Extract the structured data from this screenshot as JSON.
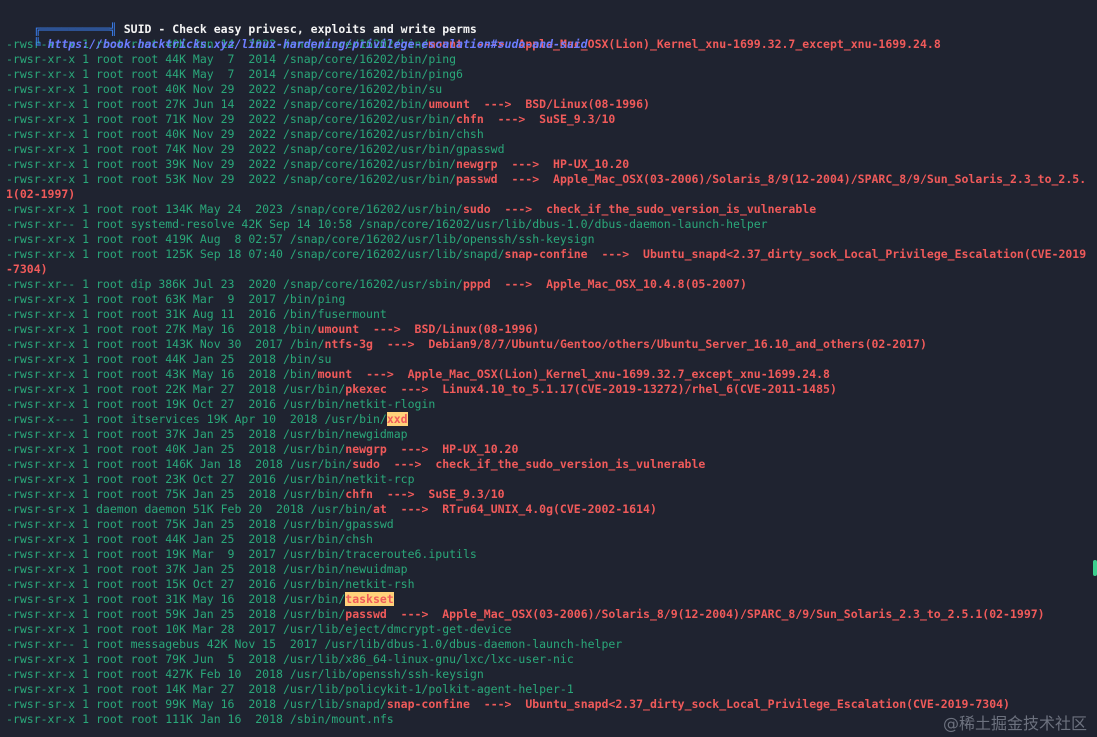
{
  "header": {
    "bracket_top": "╔══════════╣",
    "title": "SUID - Check easy privesc, exploits and write perms",
    "bracket_bottom": "╚ ",
    "url": "https://book.hacktricks.xyz/linux-hardening/privilege-escalation#sudo-and-suid"
  },
  "arrow": "--->",
  "rows": [
    {
      "meta": "-rwsr-xr-x 1 root root 40K Jun 14  2022 ",
      "dir": "/snap/core/16202/bin/",
      "bin": "mount",
      "style": "red",
      "exploit": "Apple_Mac_OSX(Lion)_Kernel_xnu-1699.32.7_except_xnu-1699.24.8"
    },
    {
      "meta": "-rwsr-xr-x 1 root root 44K May  7  2014 ",
      "dir": "/snap/core/16202/bin/",
      "bin": "ping",
      "style": "plain",
      "exploit": ""
    },
    {
      "meta": "-rwsr-xr-x 1 root root 44K May  7  2014 ",
      "dir": "/snap/core/16202/bin/",
      "bin": "ping6",
      "style": "plain",
      "exploit": ""
    },
    {
      "meta": "-rwsr-xr-x 1 root root 40K Nov 29  2022 ",
      "dir": "/snap/core/16202/bin/",
      "bin": "su",
      "style": "plain",
      "exploit": ""
    },
    {
      "meta": "-rwsr-xr-x 1 root root 27K Jun 14  2022 ",
      "dir": "/snap/core/16202/bin/",
      "bin": "umount",
      "style": "red",
      "exploit": "BSD/Linux(08-1996)"
    },
    {
      "meta": "-rwsr-xr-x 1 root root 71K Nov 29  2022 ",
      "dir": "/snap/core/16202/usr/bin/",
      "bin": "chfn",
      "style": "red",
      "exploit": "SuSE_9.3/10"
    },
    {
      "meta": "-rwsr-xr-x 1 root root 40K Nov 29  2022 ",
      "dir": "/snap/core/16202/usr/bin/",
      "bin": "chsh",
      "style": "plain",
      "exploit": ""
    },
    {
      "meta": "-rwsr-xr-x 1 root root 74K Nov 29  2022 ",
      "dir": "/snap/core/16202/usr/bin/",
      "bin": "gpasswd",
      "style": "plain",
      "exploit": ""
    },
    {
      "meta": "-rwsr-xr-x 1 root root 39K Nov 29  2022 ",
      "dir": "/snap/core/16202/usr/bin/",
      "bin": "newgrp",
      "style": "red",
      "exploit": "HP-UX_10.20"
    },
    {
      "meta": "-rwsr-xr-x 1 root root 53K Nov 29  2022 ",
      "dir": "/snap/core/16202/usr/bin/",
      "bin": "passwd",
      "style": "red",
      "exploit": "Apple_Mac_OSX(03-2006)/Solaris_8/9(12-2004)/SPARC_8/9/Sun_Solaris_2.3_to_2.5.1(02-1997)",
      "wrap": true
    },
    {
      "meta": "-rwsr-xr-x 1 root root 134K May 24  2023 ",
      "dir": "/snap/core/16202/usr/bin/",
      "bin": "sudo",
      "style": "red",
      "exploit": "check_if_the_sudo_version_is_vulnerable"
    },
    {
      "meta": "-rwsr-xr-- 1 root systemd-resolve 42K Sep 14 10:58 ",
      "dir": "/snap/core/16202/usr/lib/dbus-1.0/",
      "bin": "dbus-daemon-launch-helper",
      "style": "plain",
      "exploit": ""
    },
    {
      "meta": "-rwsr-xr-x 1 root root 419K Aug  8 02:57 ",
      "dir": "/snap/core/16202/usr/lib/openssh/",
      "bin": "ssh-keysign",
      "style": "plain",
      "exploit": ""
    },
    {
      "meta": "-rwsr-xr-x 1 root root 125K Sep 18 07:40 ",
      "dir": "/snap/core/16202/usr/lib/snapd/",
      "bin": "snap-confine",
      "style": "red",
      "exploit": "Ubuntu_snapd<2.37_dirty_sock_Local_Privilege_Escalation(CVE-2019-7304)",
      "wrap": true
    },
    {
      "meta": "-rwsr-xr-- 1 root dip 386K Jul 23  2020 ",
      "dir": "/snap/core/16202/usr/sbin/",
      "bin": "pppd",
      "style": "red",
      "exploit": "Apple_Mac_OSX_10.4.8(05-2007)"
    },
    {
      "meta": "-rwsr-xr-x 1 root root 63K Mar  9  2017 ",
      "dir": "/bin/",
      "bin": "ping",
      "style": "plain",
      "exploit": ""
    },
    {
      "meta": "-rwsr-xr-x 1 root root 31K Aug 11  2016 ",
      "dir": "/bin/",
      "bin": "fusermount",
      "style": "plain",
      "exploit": ""
    },
    {
      "meta": "-rwsr-xr-x 1 root root 27K May 16  2018 ",
      "dir": "/bin/",
      "bin": "umount",
      "style": "red",
      "exploit": "BSD/Linux(08-1996)"
    },
    {
      "meta": "-rwsr-xr-x 1 root root 143K Nov 30  2017 ",
      "dir": "/bin/",
      "bin": "ntfs-3g",
      "style": "red",
      "exploit": "Debian9/8/7/Ubuntu/Gentoo/others/Ubuntu_Server_16.10_and_others(02-2017)"
    },
    {
      "meta": "-rwsr-xr-x 1 root root 44K Jan 25  2018 ",
      "dir": "/bin/",
      "bin": "su",
      "style": "plain",
      "exploit": ""
    },
    {
      "meta": "-rwsr-xr-x 1 root root 43K May 16  2018 ",
      "dir": "/bin/",
      "bin": "mount",
      "style": "red",
      "exploit": "Apple_Mac_OSX(Lion)_Kernel_xnu-1699.32.7_except_xnu-1699.24.8"
    },
    {
      "meta": "-rwsr-xr-x 1 root root 22K Mar 27  2018 ",
      "dir": "/usr/bin/",
      "bin": "pkexec",
      "style": "red",
      "exploit": "Linux4.10_to_5.1.17(CVE-2019-13272)/rhel_6(CVE-2011-1485)"
    },
    {
      "meta": "-rwsr-xr-x 1 root root 19K Oct 27  2016 ",
      "dir": "/usr/bin/",
      "bin": "netkit-rlogin",
      "style": "plain",
      "exploit": ""
    },
    {
      "meta": "-rwsr-x--- 1 root itservices 19K Apr 10  2018 ",
      "dir": "/usr/bin/",
      "bin": "xxd",
      "style": "hl",
      "exploit": ""
    },
    {
      "meta": "-rwsr-xr-x 1 root root 37K Jan 25  2018 ",
      "dir": "/usr/bin/",
      "bin": "newgidmap",
      "style": "plain",
      "exploit": ""
    },
    {
      "meta": "-rwsr-xr-x 1 root root 40K Jan 25  2018 ",
      "dir": "/usr/bin/",
      "bin": "newgrp",
      "style": "red",
      "exploit": "HP-UX_10.20"
    },
    {
      "meta": "-rwsr-xr-x 1 root root 146K Jan 18  2018 ",
      "dir": "/usr/bin/",
      "bin": "sudo",
      "style": "red",
      "exploit": "check_if_the_sudo_version_is_vulnerable"
    },
    {
      "meta": "-rwsr-xr-x 1 root root 23K Oct 27  2016 ",
      "dir": "/usr/bin/",
      "bin": "netkit-rcp",
      "style": "plain",
      "exploit": ""
    },
    {
      "meta": "-rwsr-xr-x 1 root root 75K Jan 25  2018 ",
      "dir": "/usr/bin/",
      "bin": "chfn",
      "style": "red",
      "exploit": "SuSE_9.3/10"
    },
    {
      "meta": "-rwsr-sr-x 1 daemon daemon 51K Feb 20  2018 ",
      "dir": "/usr/bin/",
      "bin": "at",
      "style": "red",
      "exploit": "RTru64_UNIX_4.0g(CVE-2002-1614)"
    },
    {
      "meta": "-rwsr-xr-x 1 root root 75K Jan 25  2018 ",
      "dir": "/usr/bin/",
      "bin": "gpasswd",
      "style": "plain",
      "exploit": ""
    },
    {
      "meta": "-rwsr-xr-x 1 root root 44K Jan 25  2018 ",
      "dir": "/usr/bin/",
      "bin": "chsh",
      "style": "plain",
      "exploit": ""
    },
    {
      "meta": "-rwsr-xr-x 1 root root 19K Mar  9  2017 ",
      "dir": "/usr/bin/",
      "bin": "traceroute6.iputils",
      "style": "plain",
      "exploit": ""
    },
    {
      "meta": "-rwsr-xr-x 1 root root 37K Jan 25  2018 ",
      "dir": "/usr/bin/",
      "bin": "newuidmap",
      "style": "plain",
      "exploit": ""
    },
    {
      "meta": "-rwsr-xr-x 1 root root 15K Oct 27  2016 ",
      "dir": "/usr/bin/",
      "bin": "netkit-rsh",
      "style": "plain",
      "exploit": ""
    },
    {
      "meta": "-rwsr-sr-x 1 root root 31K May 16  2018 ",
      "dir": "/usr/bin/",
      "bin": "taskset",
      "style": "hl",
      "exploit": ""
    },
    {
      "meta": "-rwsr-xr-x 1 root root 59K Jan 25  2018 ",
      "dir": "/usr/bin/",
      "bin": "passwd",
      "style": "red",
      "exploit": "Apple_Mac_OSX(03-2006)/Solaris_8/9(12-2004)/SPARC_8/9/Sun_Solaris_2.3_to_2.5.1(02-1997)"
    },
    {
      "meta": "-rwsr-xr-x 1 root root 10K Mar 28  2017 ",
      "dir": "/usr/lib/eject/",
      "bin": "dmcrypt-get-device",
      "style": "plain",
      "exploit": ""
    },
    {
      "meta": "-rwsr-xr-- 1 root messagebus 42K Nov 15  2017 ",
      "dir": "/usr/lib/dbus-1.0/",
      "bin": "dbus-daemon-launch-helper",
      "style": "plain",
      "exploit": ""
    },
    {
      "meta": "-rwsr-xr-x 1 root root 79K Jun  5  2018 ",
      "dir": "/usr/lib/x86_64-linux-gnu/lxc/",
      "bin": "lxc-user-nic",
      "style": "plain",
      "exploit": ""
    },
    {
      "meta": "-rwsr-xr-x 1 root root 427K Feb 10  2018 ",
      "dir": "/usr/lib/openssh/",
      "bin": "ssh-keysign",
      "style": "plain",
      "exploit": ""
    },
    {
      "meta": "-rwsr-xr-x 1 root root 14K Mar 27  2018 ",
      "dir": "/usr/lib/policykit-1/",
      "bin": "polkit-agent-helper-1",
      "style": "plain",
      "exploit": ""
    },
    {
      "meta": "-rwsr-sr-x 1 root root 99K May 16  2018 ",
      "dir": "/usr/lib/snapd/",
      "bin": "snap-confine",
      "style": "red",
      "exploit": "Ubuntu_snapd<2.37_dirty_sock_Local_Privilege_Escalation(CVE-2019-7304)"
    },
    {
      "meta": "-rwsr-xr-x 1 root root 111K Jan 16  2018 ",
      "dir": "/sbin/",
      "bin": "mount.nfs",
      "style": "plain",
      "exploit": ""
    }
  ],
  "watermark": "@稀土掘金技术社区"
}
